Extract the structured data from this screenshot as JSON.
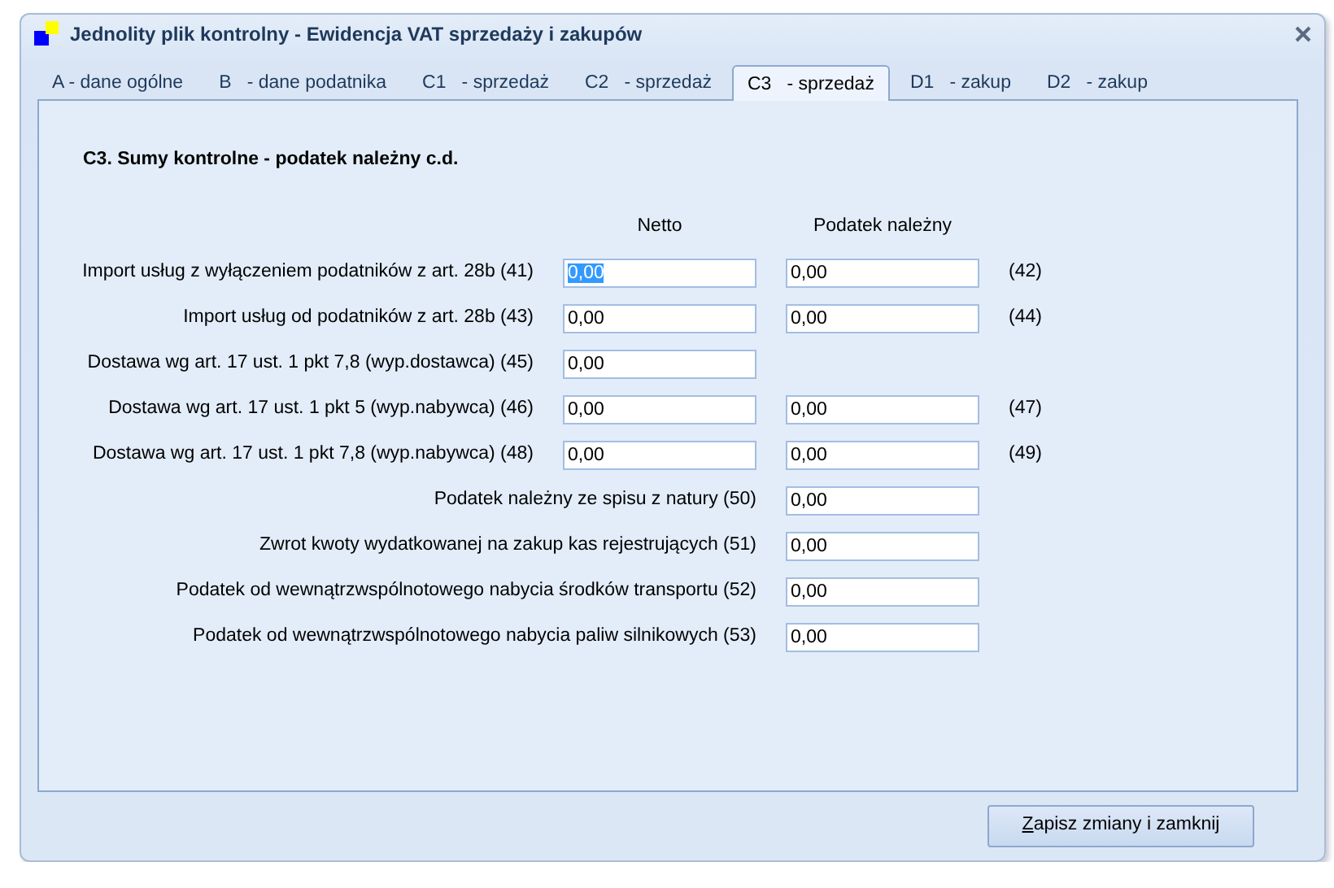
{
  "window": {
    "title": "Jednolity plik kontrolny - Ewidencja VAT sprzedaży i zakupów"
  },
  "tabs": [
    {
      "label": "A - dane ogólne",
      "selected": false
    },
    {
      "label": "B   - dane podatnika",
      "selected": false
    },
    {
      "label": "C1   - sprzedaż",
      "selected": false
    },
    {
      "label": "C2   - sprzedaż",
      "selected": false
    },
    {
      "label": "C3   - sprzedaż",
      "selected": true
    },
    {
      "label": "D1   - zakup",
      "selected": false
    },
    {
      "label": "D2   - zakup",
      "selected": false
    }
  ],
  "section_title": "C3. Sumy kontrolne - podatek należny c.d.",
  "columns": [
    "Netto",
    "Podatek należny"
  ],
  "rows": [
    {
      "label": "Import usług z wyłączeniem podatników z art. 28b (41)",
      "netto": {
        "value": "0,00",
        "text_selected": true
      },
      "tax": {
        "value": "0,00",
        "text_selected": false
      },
      "code": "(42)"
    },
    {
      "label": "Import usług od podatników z art. 28b (43)",
      "netto": {
        "value": "0,00",
        "text_selected": false
      },
      "tax": {
        "value": "0,00",
        "text_selected": false
      },
      "code": "(44)"
    },
    {
      "label": "Dostawa wg art. 17 ust. 1 pkt 7,8 (wyp.dostawca) (45)",
      "netto": {
        "value": "0,00",
        "text_selected": false
      }
    },
    {
      "label": "Dostawa wg art. 17 ust. 1 pkt 5 (wyp.nabywca) (46)",
      "netto": {
        "value": "0,00",
        "text_selected": false
      },
      "tax": {
        "value": "0,00",
        "text_selected": false
      },
      "code": "(47)"
    },
    {
      "label": "Dostawa wg art. 17 ust. 1 pkt 7,8 (wyp.nabywca) (48)",
      "netto": {
        "value": "0,00",
        "text_selected": false
      },
      "tax": {
        "value": "0,00",
        "text_selected": false
      },
      "code": "(49)"
    },
    {
      "label": "Podatek należny ze spisu z natury (50)",
      "tax": {
        "value": "0,00",
        "text_selected": false
      }
    },
    {
      "label": "Zwrot kwoty wydatkowanej na zakup kas rejestrujących (51)",
      "tax": {
        "value": "0,00",
        "text_selected": false
      }
    },
    {
      "label": "Podatek od wewnątrzwspólnotowego nabycia środków transportu (52)",
      "tax": {
        "value": "0,00",
        "text_selected": false
      }
    },
    {
      "label": "Podatek od wewnątrzwspólnotowego nabycia paliw silnikowych (53)",
      "tax": {
        "value": "0,00",
        "text_selected": false
      }
    }
  ],
  "save_button": {
    "label": "Zapisz zmiany i zamknij",
    "first_letter_underlined": true
  }
}
